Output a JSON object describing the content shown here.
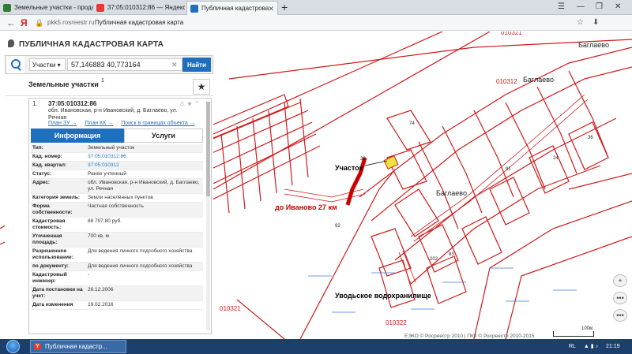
{
  "browser": {
    "tabs": [
      {
        "label": "Земельные участки - прода",
        "favicon_color": "#2e7d32"
      },
      {
        "label": "37:05:010312:86 — Яндекс",
        "favicon_color": "#e53935"
      },
      {
        "label": "Публичная кадастрова",
        "favicon_color": "#1f6fbf"
      }
    ],
    "url_domain": "pkk5.rosreestr.ru",
    "page_title": "Публичная кадастровая карта"
  },
  "panel": {
    "logo_text": "ПУБЛИЧНАЯ КАДАСТРОВАЯ КАРТА",
    "search": {
      "type_label": "Участки",
      "query": "57,146883 40,773164",
      "button_label": "Найти"
    },
    "results": {
      "title": "Земельные участки",
      "count": "1"
    },
    "card": {
      "number": "1.",
      "cad_number": "37:05:010312:86",
      "address": "обл. Ивановская, р-н Ивановский, д. Баглаево, ул. Речная",
      "links": [
        "План ЗУ →",
        "План КК →",
        "Поиск в границах объекта →"
      ],
      "tabs": {
        "info": "Информация",
        "services": "Услуги"
      },
      "properties": [
        {
          "key": "Тип:",
          "value": "Земельный участок"
        },
        {
          "key": "Кад. номер:",
          "value": "37:05:010312:86",
          "link": true
        },
        {
          "key": "Кад. квартал:",
          "value": "37:05:010312",
          "link": true
        },
        {
          "key": "Статус:",
          "value": "Ранее учтенный"
        },
        {
          "key": "Адрес:",
          "value": "обл. Ивановская, р-н Ивановский, д. Баглаево, ул. Речная"
        },
        {
          "key": "Категория земель:",
          "value": "Земли населённых пунктов"
        },
        {
          "key": "Форма собственности:",
          "value": "Частная собственность"
        },
        {
          "key": "Кадастровая стоимость:",
          "value": "88 797,80 руб."
        },
        {
          "key": "Уточненная площадь:",
          "value": "700 кв. м"
        },
        {
          "key": "Разрешенное использование:",
          "value": "Для ведения личного подсобного хозяйства"
        },
        {
          "key": "по документу:",
          "value": "Для ведения личного подсобного хозяйства"
        },
        {
          "key": "Кадастровый инженер:",
          "value": "-"
        },
        {
          "key": "Дата постановки на учет:",
          "value": "26.12.2006"
        },
        {
          "key": "Дата изменения",
          "value": "19.02.2016"
        }
      ]
    }
  },
  "map": {
    "labels": {
      "village_top": "Баглаево",
      "village_mid": "Баглаево",
      "village_main": "Баглаево",
      "plot_label": "Участок",
      "road_label": "до Иваново 27 км",
      "reservoir": "Уводьское водохранилище",
      "q_010321_top": "010321",
      "q_010312": "010312",
      "q_010321_bottom": "010321",
      "q_010322": "010322",
      "n33": "33",
      "n92": "92",
      "n74": "74",
      "n83": "83",
      "n202": "202",
      "n91": "91",
      "n24": "24",
      "n36": "36"
    },
    "copyright": "ЕЭКО © Росреестр 2010 | ПКК © Росреестр 2010-2015",
    "scale": "100м",
    "colors": {
      "boundary": "#d11a1a",
      "selected": "#f0e040",
      "road_highlight": "#cc0000"
    }
  },
  "taskbar": {
    "item": "Публичная кадастр...",
    "lang": "RL",
    "time": "21:19"
  }
}
